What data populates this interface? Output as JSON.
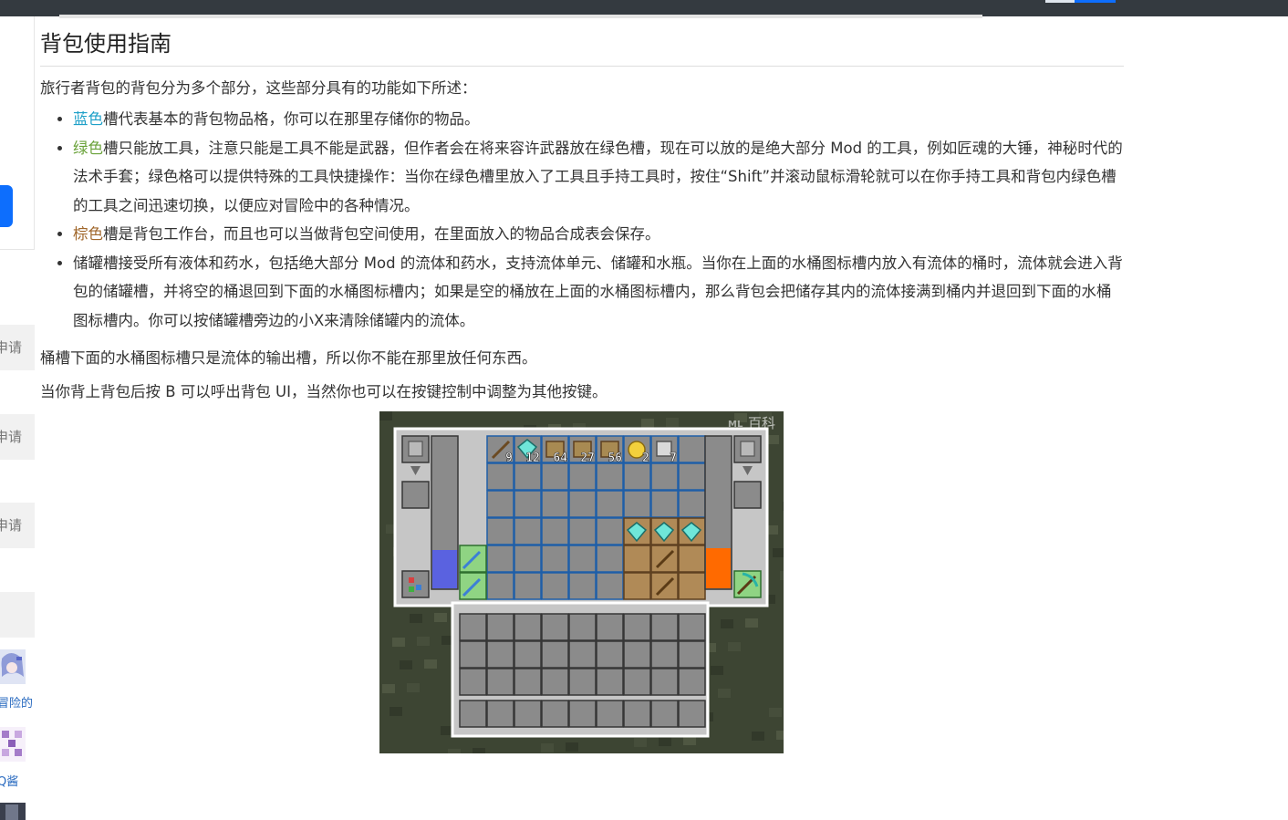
{
  "left_sidebar": {
    "apply_items": [
      "申请",
      "申请",
      "申请"
    ],
    "users": [
      {
        "name": "冒险的"
      },
      {
        "name": "Q酱"
      }
    ]
  },
  "article": {
    "heading": "背包使用指南",
    "intro": "旅行者背包的背包分为多个部分，这些部分具有的功能如下所述：",
    "list": [
      {
        "highlight": "蓝色",
        "color": "#1ea0c8",
        "text": "槽代表基本的背包物品格，你可以在那里存储你的物品。"
      },
      {
        "highlight": "绿色",
        "color": "#6aa23a",
        "text": "槽只能放工具，注意只能是工具不能是武器，但作者会在将来容许武器放在绿色槽，现在可以放的是绝大部分 Mod 的工具，例如匠魂的大锤，神秘时代的法术手套；绿色格可以提供特殊的工具快捷操作：当你在绿色槽里放入了工具且手持工具时，按住“Shift”并滚动鼠标滑轮就可以在你手持工具和背包内绿色槽的工具之间迅速切换，以便应对冒险中的各种情况。"
      },
      {
        "highlight": "棕色",
        "color": "#a0672b",
        "text": "槽是背包工作台，而且也可以当做背包空间使用，在里面放入的物品合成表会保存。"
      },
      {
        "highlight": "",
        "color": "",
        "text": "储罐槽接受所有液体和药水，包括绝大部分 Mod 的流体和药水，支持流体单元、储罐和水瓶。当你在上面的水桶图标槽内放入有流体的桶时，流体就会进入背包的储罐槽，并将空的桶退回到下面的水桶图标槽内；如果是空的桶放在上面的水桶图标槽内，那么背包会把储存其内的流体接满到桶内并退回到下面的水桶图标槽内。你可以按储罐槽旁边的小X来清除储罐内的流体。"
      }
    ],
    "para2": "桶槽下面的水桶图标槽只是流体的输出槽，所以你不能在那里放任何东西。",
    "para3": "当你背上背包后按 B 可以呼出背包 UI，当然你也可以在按键控制中调整为其他按键。"
  },
  "screenshot": {
    "watermark": "百科",
    "watermark_badge": "ML",
    "top_row_counts": [
      "9",
      "12",
      "64",
      "27",
      "56",
      "2",
      "7"
    ],
    "colors": {
      "blue_slot": "#1f5fa8",
      "green_slot": "#8fd483",
      "brown_slot": "#b08a57",
      "water": "#5a62e0",
      "lava": "#ff6a00"
    }
  }
}
